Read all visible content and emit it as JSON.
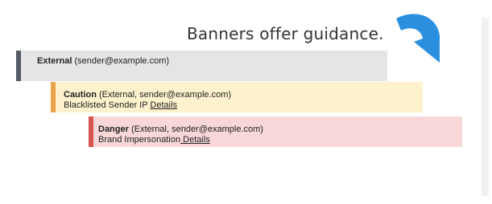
{
  "headline": "Banners offer guidance.",
  "colors": {
    "external_stripe": "#555b63",
    "external_bg": "#e5e5e7",
    "caution_stripe": "#e8a447",
    "caution_bg": "#fdf2cd",
    "danger_stripe": "#d9534f",
    "danger_bg": "#f7d7d8",
    "arrow": "#2b8fe0"
  },
  "icons": {
    "arrow": "curved-arrow-icon"
  },
  "banners": {
    "external": {
      "level": "External",
      "detail": " (sender@example.com)"
    },
    "caution": {
      "level": "Caution",
      "detail": " (External, sender@example.com)",
      "message": "Blacklisted Sender IP ",
      "link": "Details"
    },
    "danger": {
      "level": "Danger",
      "detail": " (External, sender@example.com)",
      "message": "Brand Impersonation",
      "link": " Details"
    }
  }
}
